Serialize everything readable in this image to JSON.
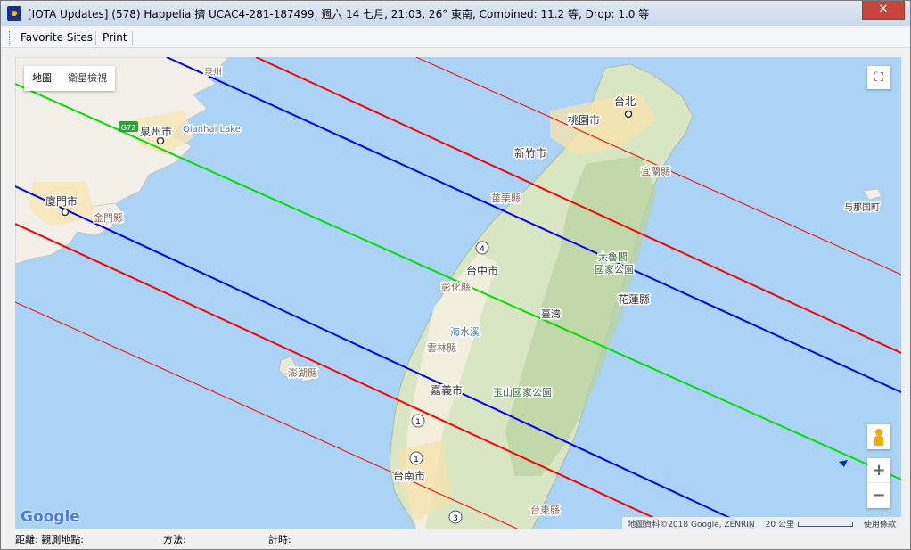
{
  "window": {
    "title": "[IOTA Updates] (578) Happelia 擠 UCAC4-281-187499, 週六 14 七月, 21:03, 26° 東南, Combined: 11.2 等, Drop:  1.0 等",
    "close_label": "✕"
  },
  "menu": {
    "items": [
      "Favorite Sites",
      "Print"
    ]
  },
  "map": {
    "type_buttons": [
      "地圖",
      "衛星檢視"
    ],
    "fullscreen_icon": "fullscreen-icon",
    "zoom_in": "+",
    "zoom_out": "−",
    "logo": "Google",
    "attribution": "地圖資料©2018 Google, ZENRIN",
    "scale": "20 公里",
    "terms": "使用條款",
    "labels": {
      "taipei": "台北",
      "taoyuan": "桃園市",
      "hsinchu": "新竹市",
      "yilan": "宜蘭縣",
      "miaoli": "苗栗縣",
      "taichung": "台中市",
      "changhua": "彰化縣",
      "taroko": "太魯閣\n國家公園",
      "hualien": "花蓮縣",
      "taiwan": "臺灣",
      "yunlin": "雲林縣",
      "haianxi": "海水溪",
      "penghu": "澎湖縣",
      "chiayi": "嘉義市",
      "yushan": "玉山國家公園",
      "tainan": "台南市",
      "taitung": "台東縣",
      "quanzhou": "泉州市",
      "qianhai": "Qianhai Lake",
      "xiamen": "廈門市",
      "kinmen": "金門縣",
      "yonaguni": "与那国町",
      "g72": "G72",
      "fujian_partial": "泉州",
      "road4": "4",
      "road1a": "1",
      "road1b": "1",
      "road3": "3"
    },
    "line_colors": {
      "center": "#00e000",
      "path_limit": "#0000ff",
      "sigma": "#ff0000",
      "outer": "#ff0000"
    }
  },
  "status": {
    "distance_label": "距離: 觀測地點:",
    "method_label": "方法:",
    "timing_label": "計時:"
  }
}
